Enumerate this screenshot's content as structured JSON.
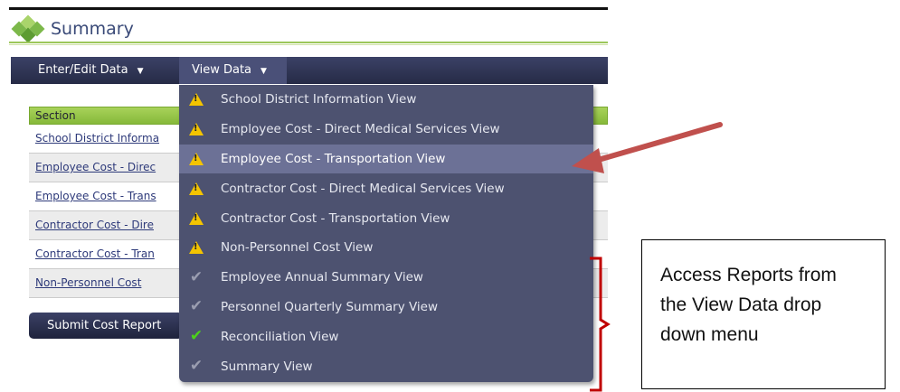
{
  "header": {
    "title": "Summary"
  },
  "nav": {
    "enter_edit": "Enter/Edit Data",
    "view_data": "View Data",
    "caret": "▼"
  },
  "table": {
    "header": "Section",
    "rows": [
      "School District Informa",
      "Employee Cost - Direc",
      "Employee Cost - Trans",
      "Contractor Cost - Dire",
      "Contractor Cost - Tran",
      "Non-Personnel Cost"
    ]
  },
  "submit_button": "Submit Cost Report",
  "dropdown": {
    "items": [
      {
        "label": "School District Information View",
        "icon": "warning-icon"
      },
      {
        "label": "Employee Cost - Direct Medical Services View",
        "icon": "warning-icon"
      },
      {
        "label": "Employee Cost - Transportation View",
        "icon": "warning-icon",
        "selected": true
      },
      {
        "label": "Contractor Cost - Direct Medical Services View",
        "icon": "warning-icon"
      },
      {
        "label": "Contractor Cost - Transportation View",
        "icon": "warning-icon"
      },
      {
        "label": "Non-Personnel Cost View",
        "icon": "warning-icon"
      },
      {
        "label": "Employee Annual Summary View",
        "icon": "gray-check-icon"
      },
      {
        "label": "Personnel Quarterly Summary View",
        "icon": "gray-check-icon"
      },
      {
        "label": "Reconciliation View",
        "icon": "green-check-icon"
      },
      {
        "label": "Summary View",
        "icon": "gray-check-icon"
      }
    ]
  },
  "callout": {
    "lines": [
      "Access Reports from",
      "the View Data drop",
      "down menu"
    ]
  },
  "colors": {
    "nav_bg": "#262b46",
    "menu_bg": "#4d5270",
    "selected": "#6c7196",
    "accent_green": "#86b93a",
    "arrow_red": "#c0504d"
  }
}
